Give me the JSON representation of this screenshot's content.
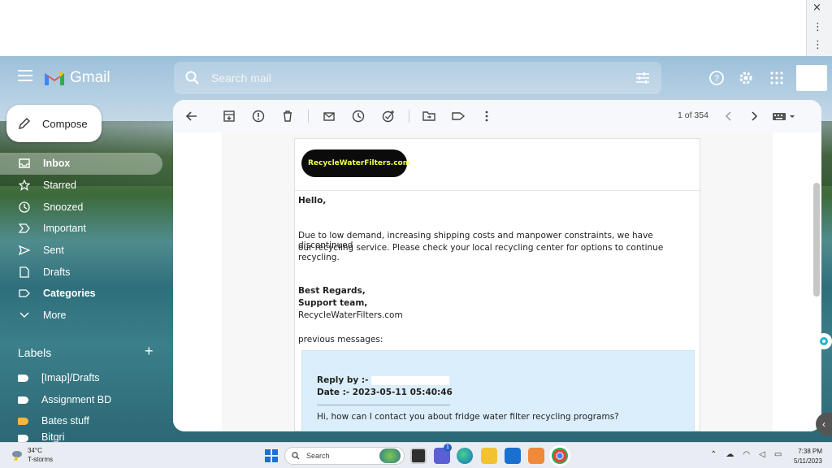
{
  "browser": {
    "close_icon": "×",
    "menu_icon": "⋮"
  },
  "gmail": {
    "brand": "Gmail",
    "search": {
      "placeholder": "Search mail"
    },
    "compose_label": "Compose",
    "nav": [
      {
        "label": "Inbox",
        "icon": "inbox-icon",
        "active": true
      },
      {
        "label": "Starred",
        "icon": "star-icon"
      },
      {
        "label": "Snoozed",
        "icon": "clock-icon"
      },
      {
        "label": "Important",
        "icon": "important-icon"
      },
      {
        "label": "Sent",
        "icon": "send-icon"
      },
      {
        "label": "Drafts",
        "icon": "draft-icon"
      },
      {
        "label": "Categories",
        "icon": "label-icon"
      },
      {
        "label": "More",
        "icon": "chevron-down-icon"
      }
    ],
    "labels_header": "Labels",
    "labels": [
      {
        "label": "[Imap]/Drafts",
        "color": "#ffffff"
      },
      {
        "label": "Assignment BD",
        "color": "#ffffff"
      },
      {
        "label": "Bates stuff",
        "color": "#f6b73c"
      },
      {
        "label": "Bitgri",
        "color": "#ffffff"
      }
    ],
    "pager": "1 of 354"
  },
  "email": {
    "logo_text": "RecycleWaterFilters.com",
    "greeting": "Hello,",
    "body_line1": "Due to low demand, increasing shipping costs and manpower constraints, we have discontinued",
    "body_line2": "our recycling service. Please check your local recycling center for options to continue recycling.",
    "signoff": "Best Regards,",
    "team": "Support team,",
    "company": "RecycleWaterFilters.com",
    "previous_label": "previous messages:",
    "reply_by": "Reply by :-",
    "date": "Date :- 2023-05-11 05:40:46",
    "question": "Hi, how can I contact you about fridge water filter recycling programs?"
  },
  "taskbar": {
    "temp": "34°C",
    "condition": "T-storms",
    "search": "Search",
    "time": "7:38 PM",
    "date": "5/11/2023",
    "badge": "1"
  }
}
